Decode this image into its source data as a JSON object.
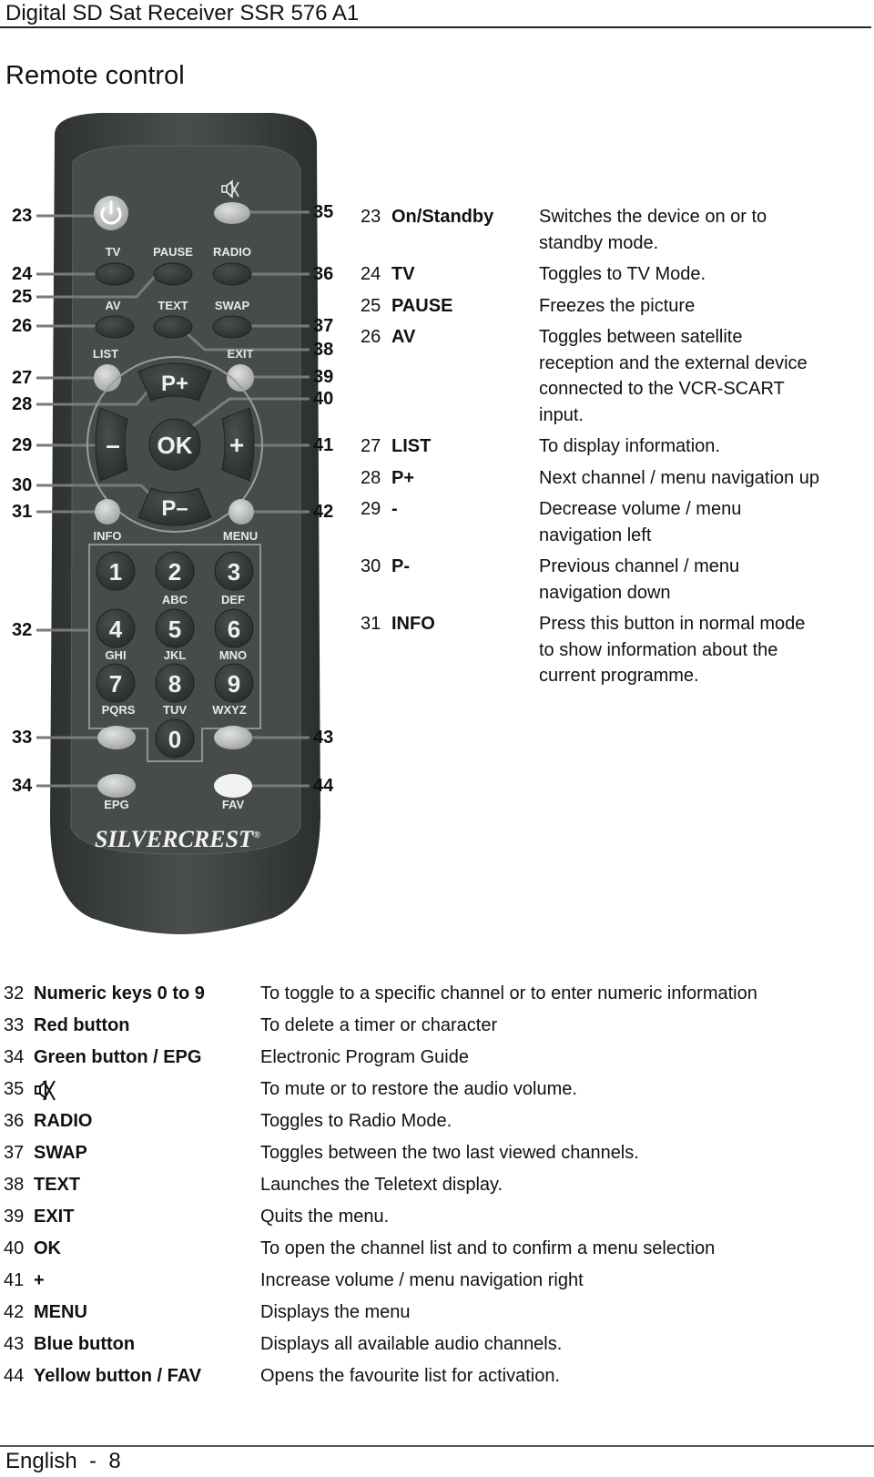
{
  "header": {
    "title": "Digital SD Sat Receiver SSR 576 A1"
  },
  "section": {
    "title": "Remote control"
  },
  "remote": {
    "brand": "SILVERCREST",
    "brand_mark": "®",
    "colors": {
      "body": "#3b3f40",
      "face": "#4a4f50",
      "button_dark": "#3a3d3e",
      "button_light": "#bfc2c1",
      "button_mid": "#9a9d9c",
      "label": "#e8e8e8",
      "callout_line": "#777777"
    },
    "labels": {
      "tv": "TV",
      "pause": "PAUSE",
      "radio": "RADIO",
      "av": "AV",
      "text": "TEXT",
      "swap": "SWAP",
      "list": "LIST",
      "exit": "EXIT",
      "p_plus": "P+",
      "p_minus": "P–",
      "ok": "OK",
      "minus": "–",
      "plus": "+",
      "info": "INFO",
      "menu": "MENU",
      "abc": "ABC",
      "def": "DEF",
      "ghi": "GHI",
      "jkl": "JKL",
      "mno": "MNO",
      "pqrs": "PQRS",
      "tuv": "TUV",
      "wxyz": "WXYZ",
      "epg": "EPG",
      "fav": "FAV"
    },
    "digits": [
      "1",
      "2",
      "3",
      "4",
      "5",
      "6",
      "7",
      "8",
      "9",
      "0"
    ],
    "callouts_left": [
      "23",
      "24",
      "25",
      "26",
      "27",
      "28",
      "29",
      "30",
      "31",
      "32",
      "33",
      "34"
    ],
    "callouts_right": [
      "35",
      "36",
      "37",
      "38",
      "39",
      "40",
      "41",
      "42",
      "43",
      "44"
    ]
  },
  "upper_table": [
    {
      "num": "23",
      "key": "On/Standby",
      "desc": "Switches the device on or to standby mode."
    },
    {
      "num": "24",
      "key": "TV",
      "desc": "Toggles to TV Mode."
    },
    {
      "num": "25",
      "key": "PAUSE",
      "desc": "Freezes the picture"
    },
    {
      "num": "26",
      "key": "AV",
      "desc": "Toggles between satellite reception and the external device connected to the VCR-SCART input."
    },
    {
      "num": "27",
      "key": "LIST",
      "desc": "To display information."
    },
    {
      "num": "28",
      "key": "P+",
      "desc": "Next channel / menu navigation up"
    },
    {
      "num": "29",
      "key": "-",
      "desc": "Decrease volume / menu navigation left"
    },
    {
      "num": "30",
      "key": "P-",
      "desc": "Previous channel / menu navigation down"
    },
    {
      "num": "31",
      "key": "INFO",
      "desc": "Press this button in normal mode to show information about the current programme."
    }
  ],
  "lower_table": [
    {
      "num": "32",
      "key": "Numeric keys 0 to 9",
      "desc": "To toggle to a specific channel or to enter numeric information"
    },
    {
      "num": "33",
      "key": "Red button",
      "desc": "To delete a timer or character"
    },
    {
      "num": "34",
      "key": "Green button / EPG",
      "desc": "Electronic Program Guide"
    },
    {
      "num": "35",
      "key": "",
      "icon": "mute-icon",
      "desc": "To mute or to restore the audio volume."
    },
    {
      "num": "36",
      "key": "RADIO",
      "desc": "Toggles to Radio Mode."
    },
    {
      "num": "37",
      "key": "SWAP",
      "desc": "Toggles between the two last viewed channels."
    },
    {
      "num": "38",
      "key": "TEXT",
      "desc": "Launches the Teletext display."
    },
    {
      "num": "39",
      "key": "EXIT",
      "desc": "Quits the menu."
    },
    {
      "num": "40",
      "key": "OK",
      "desc": "To open the channel list and to confirm a menu selection"
    },
    {
      "num": "41",
      "key": "+",
      "desc": "Increase volume / menu navigation right"
    },
    {
      "num": "42",
      "key": "MENU",
      "desc": "Displays the menu"
    },
    {
      "num": "43",
      "key": "Blue button",
      "desc": "Displays all available audio channels."
    },
    {
      "num": "44",
      "key": "Yellow button / FAV",
      "desc": "Opens the favourite list for activation."
    }
  ],
  "footer": {
    "text": "English  -  8"
  }
}
